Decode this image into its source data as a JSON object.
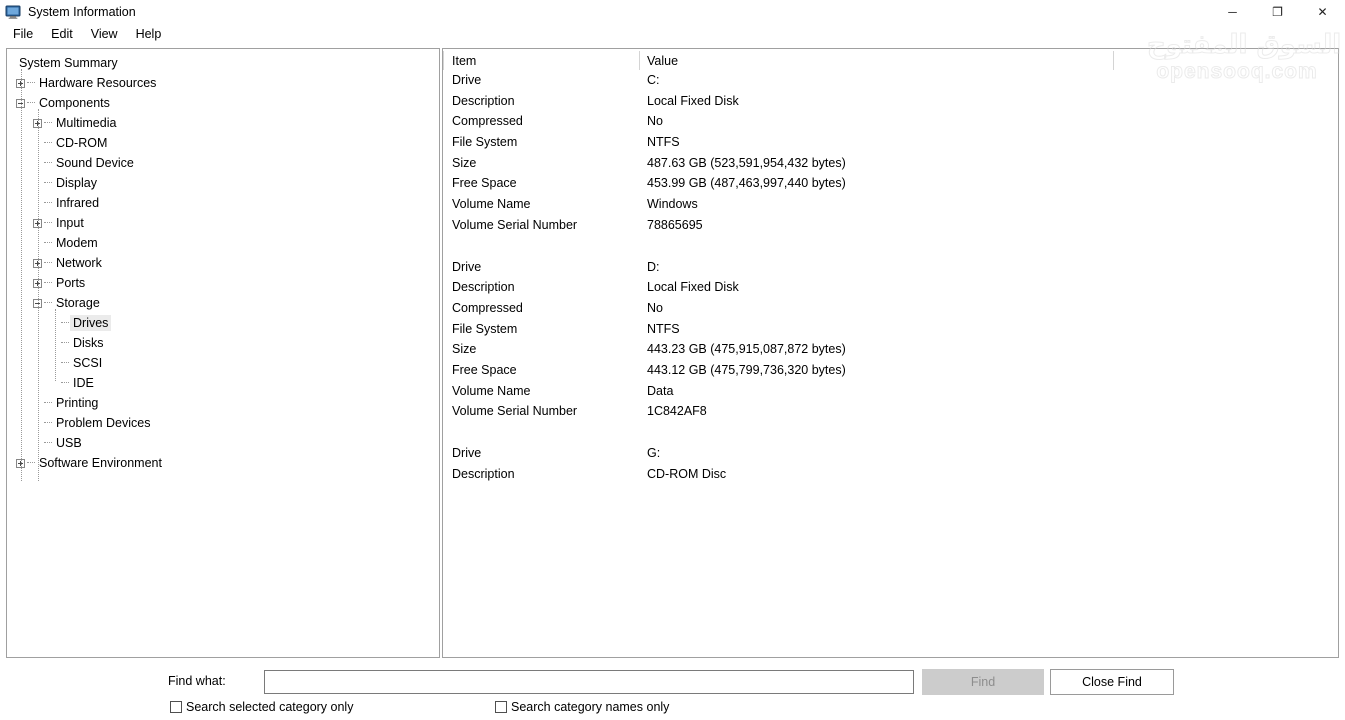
{
  "window": {
    "title": "System Information",
    "icon": "computer-icon",
    "minimize": "─",
    "maximize": "❐",
    "close": "✕"
  },
  "menubar": {
    "items": [
      {
        "label": "File"
      },
      {
        "label": "Edit"
      },
      {
        "label": "View"
      },
      {
        "label": "Help"
      }
    ]
  },
  "tree": {
    "nodes": [
      {
        "label": "System Summary",
        "level": 0,
        "expander": "none",
        "selected": false
      },
      {
        "label": "Hardware Resources",
        "level": 0,
        "expander": "plus",
        "selected": false
      },
      {
        "label": "Components",
        "level": 0,
        "expander": "minus",
        "selected": false
      },
      {
        "label": "Multimedia",
        "level": 1,
        "expander": "plus",
        "selected": false
      },
      {
        "label": "CD-ROM",
        "level": 1,
        "expander": "none",
        "selected": false
      },
      {
        "label": "Sound Device",
        "level": 1,
        "expander": "none",
        "selected": false
      },
      {
        "label": "Display",
        "level": 1,
        "expander": "none",
        "selected": false
      },
      {
        "label": "Infrared",
        "level": 1,
        "expander": "none",
        "selected": false
      },
      {
        "label": "Input",
        "level": 1,
        "expander": "plus",
        "selected": false
      },
      {
        "label": "Modem",
        "level": 1,
        "expander": "none",
        "selected": false
      },
      {
        "label": "Network",
        "level": 1,
        "expander": "plus",
        "selected": false
      },
      {
        "label": "Ports",
        "level": 1,
        "expander": "plus",
        "selected": false
      },
      {
        "label": "Storage",
        "level": 1,
        "expander": "minus",
        "selected": false
      },
      {
        "label": "Drives",
        "level": 2,
        "expander": "none",
        "selected": true
      },
      {
        "label": "Disks",
        "level": 2,
        "expander": "none",
        "selected": false
      },
      {
        "label": "SCSI",
        "level": 2,
        "expander": "none",
        "selected": false
      },
      {
        "label": "IDE",
        "level": 2,
        "expander": "none",
        "selected": false
      },
      {
        "label": "Printing",
        "level": 1,
        "expander": "none",
        "selected": false
      },
      {
        "label": "Problem Devices",
        "level": 1,
        "expander": "none",
        "selected": false
      },
      {
        "label": "USB",
        "level": 1,
        "expander": "none",
        "selected": false
      },
      {
        "label": "Software Environment",
        "level": 0,
        "expander": "plus",
        "selected": false
      }
    ]
  },
  "detail": {
    "columns": [
      {
        "label": "Item"
      },
      {
        "label": "Value"
      }
    ],
    "rows": [
      {
        "item": "Drive",
        "value": "C:"
      },
      {
        "item": "Description",
        "value": "Local Fixed Disk"
      },
      {
        "item": "Compressed",
        "value": "No"
      },
      {
        "item": "File System",
        "value": "NTFS"
      },
      {
        "item": "Size",
        "value": "487.63 GB (523,591,954,432 bytes)"
      },
      {
        "item": "Free Space",
        "value": "453.99 GB (487,463,997,440 bytes)"
      },
      {
        "item": "Volume Name",
        "value": "Windows"
      },
      {
        "item": "Volume Serial Number",
        "value": "78865695"
      },
      {
        "item": "",
        "value": ""
      },
      {
        "item": "Drive",
        "value": "D:"
      },
      {
        "item": "Description",
        "value": "Local Fixed Disk"
      },
      {
        "item": "Compressed",
        "value": "No"
      },
      {
        "item": "File System",
        "value": "NTFS"
      },
      {
        "item": "Size",
        "value": "443.23 GB (475,915,087,872 bytes)"
      },
      {
        "item": "Free Space",
        "value": "443.12 GB (475,799,736,320 bytes)"
      },
      {
        "item": "Volume Name",
        "value": "Data"
      },
      {
        "item": "Volume Serial Number",
        "value": "1C842AF8"
      },
      {
        "item": "",
        "value": ""
      },
      {
        "item": "Drive",
        "value": "G:"
      },
      {
        "item": "Description",
        "value": "CD-ROM Disc"
      }
    ]
  },
  "findbar": {
    "label": "Find what:",
    "input_value": "",
    "input_placeholder": "",
    "find_button": "Find",
    "find_button_enabled": false,
    "close_find_button": "Close Find",
    "checkbox_selected_category": {
      "label": "Search selected category only",
      "checked": false
    },
    "checkbox_category_names": {
      "label": "Search category names only",
      "checked": false
    }
  },
  "watermark": {
    "arabic": "السوق المفتوح",
    "english": "opensooq.com"
  }
}
